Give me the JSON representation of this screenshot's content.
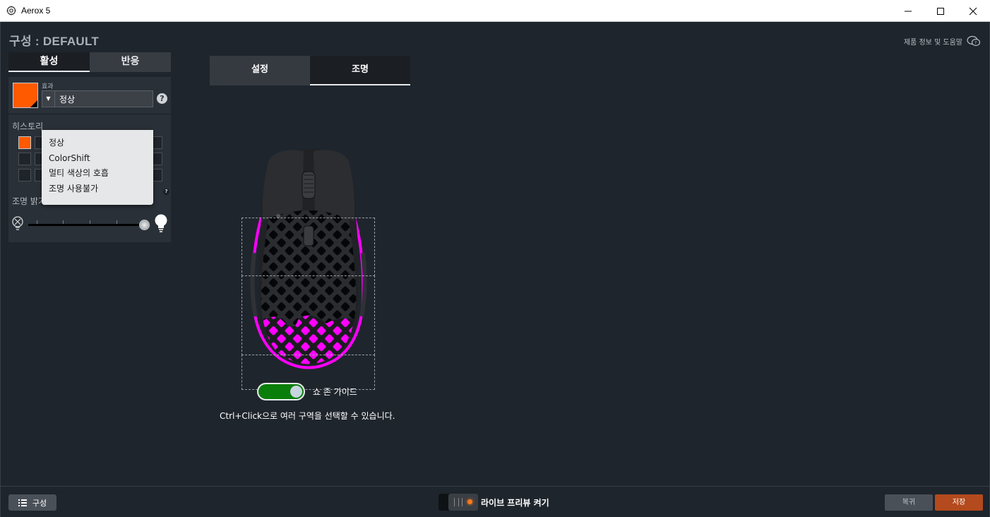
{
  "window": {
    "title": "Aerox 5"
  },
  "header": {
    "config_prefix": "구성 : ",
    "config_name": "DEFAULT",
    "help_link": "제품 정보 및 도움말"
  },
  "left_panel": {
    "tabs": [
      {
        "label": "활성",
        "active": true
      },
      {
        "label": "반응",
        "active": false
      }
    ],
    "swatch_color": "#ff5a00",
    "effect_label": "효과",
    "effect_value": "정상",
    "history_label": "히스토리",
    "brightness_label": "조명 밝기"
  },
  "effect_dropdown": {
    "options": [
      "정상",
      "ColorShift",
      "멀티 색상의 호흡",
      "조명 사용불가"
    ]
  },
  "mode_tabs": [
    {
      "label": "설정",
      "active": false
    },
    {
      "label": "조명",
      "active": true
    }
  ],
  "zone_guide": {
    "label": "쇼 존 가이드",
    "enabled": true
  },
  "hint": "Ctrl+Click으로 여러 구역을 선택할 수 있습니다.",
  "bottom": {
    "config_button": "구성",
    "live_preview": "라이브 프리뷰 켜기",
    "restore": "복귀",
    "save": "저장"
  },
  "colors": {
    "accent_orange": "#ff5a00",
    "rgb_zone": "#ff00ff",
    "toggle_on": "#0a7e0a",
    "save": "#b44a1d"
  }
}
